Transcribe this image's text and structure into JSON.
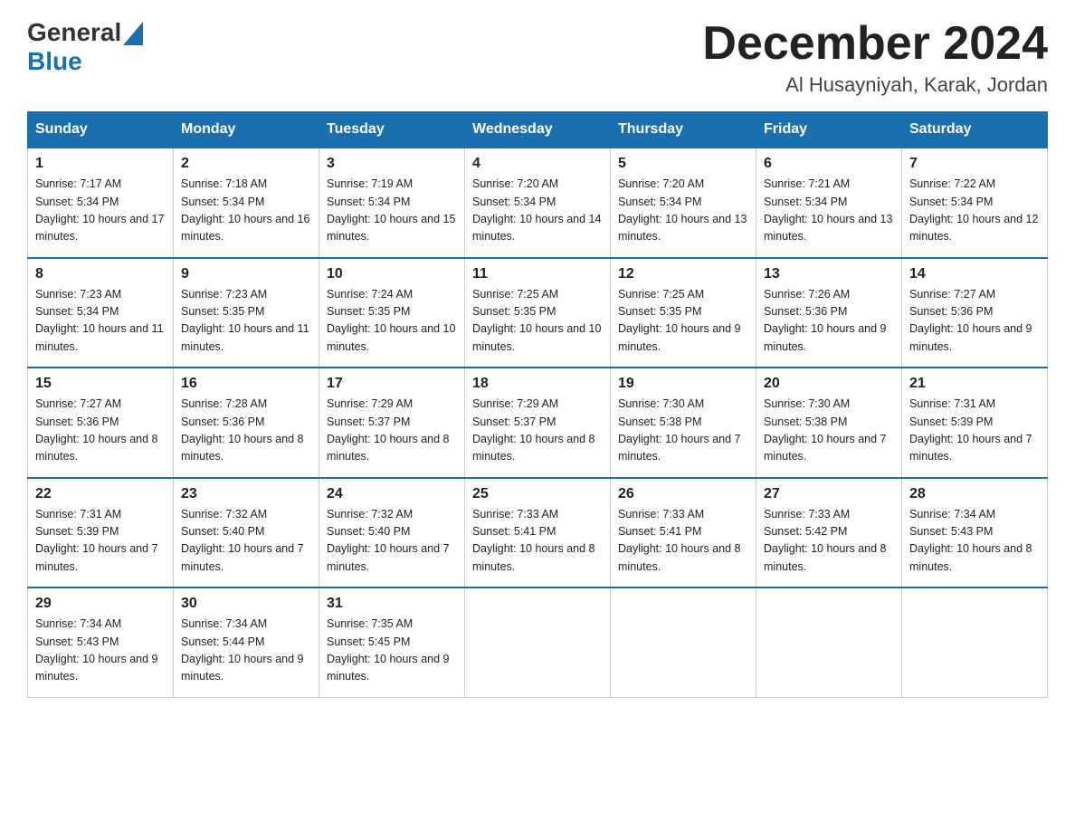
{
  "logo": {
    "text_general": "General",
    "text_blue": "Blue"
  },
  "title": {
    "month_year": "December 2024",
    "location": "Al Husayniyah, Karak, Jordan"
  },
  "days_of_week": [
    "Sunday",
    "Monday",
    "Tuesday",
    "Wednesday",
    "Thursday",
    "Friday",
    "Saturday"
  ],
  "weeks": [
    [
      {
        "day": "1",
        "sunrise": "7:17 AM",
        "sunset": "5:34 PM",
        "daylight": "10 hours and 17 minutes."
      },
      {
        "day": "2",
        "sunrise": "7:18 AM",
        "sunset": "5:34 PM",
        "daylight": "10 hours and 16 minutes."
      },
      {
        "day": "3",
        "sunrise": "7:19 AM",
        "sunset": "5:34 PM",
        "daylight": "10 hours and 15 minutes."
      },
      {
        "day": "4",
        "sunrise": "7:20 AM",
        "sunset": "5:34 PM",
        "daylight": "10 hours and 14 minutes."
      },
      {
        "day": "5",
        "sunrise": "7:20 AM",
        "sunset": "5:34 PM",
        "daylight": "10 hours and 13 minutes."
      },
      {
        "day": "6",
        "sunrise": "7:21 AM",
        "sunset": "5:34 PM",
        "daylight": "10 hours and 13 minutes."
      },
      {
        "day": "7",
        "sunrise": "7:22 AM",
        "sunset": "5:34 PM",
        "daylight": "10 hours and 12 minutes."
      }
    ],
    [
      {
        "day": "8",
        "sunrise": "7:23 AM",
        "sunset": "5:34 PM",
        "daylight": "10 hours and 11 minutes."
      },
      {
        "day": "9",
        "sunrise": "7:23 AM",
        "sunset": "5:35 PM",
        "daylight": "10 hours and 11 minutes."
      },
      {
        "day": "10",
        "sunrise": "7:24 AM",
        "sunset": "5:35 PM",
        "daylight": "10 hours and 10 minutes."
      },
      {
        "day": "11",
        "sunrise": "7:25 AM",
        "sunset": "5:35 PM",
        "daylight": "10 hours and 10 minutes."
      },
      {
        "day": "12",
        "sunrise": "7:25 AM",
        "sunset": "5:35 PM",
        "daylight": "10 hours and 9 minutes."
      },
      {
        "day": "13",
        "sunrise": "7:26 AM",
        "sunset": "5:36 PM",
        "daylight": "10 hours and 9 minutes."
      },
      {
        "day": "14",
        "sunrise": "7:27 AM",
        "sunset": "5:36 PM",
        "daylight": "10 hours and 9 minutes."
      }
    ],
    [
      {
        "day": "15",
        "sunrise": "7:27 AM",
        "sunset": "5:36 PM",
        "daylight": "10 hours and 8 minutes."
      },
      {
        "day": "16",
        "sunrise": "7:28 AM",
        "sunset": "5:36 PM",
        "daylight": "10 hours and 8 minutes."
      },
      {
        "day": "17",
        "sunrise": "7:29 AM",
        "sunset": "5:37 PM",
        "daylight": "10 hours and 8 minutes."
      },
      {
        "day": "18",
        "sunrise": "7:29 AM",
        "sunset": "5:37 PM",
        "daylight": "10 hours and 8 minutes."
      },
      {
        "day": "19",
        "sunrise": "7:30 AM",
        "sunset": "5:38 PM",
        "daylight": "10 hours and 7 minutes."
      },
      {
        "day": "20",
        "sunrise": "7:30 AM",
        "sunset": "5:38 PM",
        "daylight": "10 hours and 7 minutes."
      },
      {
        "day": "21",
        "sunrise": "7:31 AM",
        "sunset": "5:39 PM",
        "daylight": "10 hours and 7 minutes."
      }
    ],
    [
      {
        "day": "22",
        "sunrise": "7:31 AM",
        "sunset": "5:39 PM",
        "daylight": "10 hours and 7 minutes."
      },
      {
        "day": "23",
        "sunrise": "7:32 AM",
        "sunset": "5:40 PM",
        "daylight": "10 hours and 7 minutes."
      },
      {
        "day": "24",
        "sunrise": "7:32 AM",
        "sunset": "5:40 PM",
        "daylight": "10 hours and 7 minutes."
      },
      {
        "day": "25",
        "sunrise": "7:33 AM",
        "sunset": "5:41 PM",
        "daylight": "10 hours and 8 minutes."
      },
      {
        "day": "26",
        "sunrise": "7:33 AM",
        "sunset": "5:41 PM",
        "daylight": "10 hours and 8 minutes."
      },
      {
        "day": "27",
        "sunrise": "7:33 AM",
        "sunset": "5:42 PM",
        "daylight": "10 hours and 8 minutes."
      },
      {
        "day": "28",
        "sunrise": "7:34 AM",
        "sunset": "5:43 PM",
        "daylight": "10 hours and 8 minutes."
      }
    ],
    [
      {
        "day": "29",
        "sunrise": "7:34 AM",
        "sunset": "5:43 PM",
        "daylight": "10 hours and 9 minutes."
      },
      {
        "day": "30",
        "sunrise": "7:34 AM",
        "sunset": "5:44 PM",
        "daylight": "10 hours and 9 minutes."
      },
      {
        "day": "31",
        "sunrise": "7:35 AM",
        "sunset": "5:45 PM",
        "daylight": "10 hours and 9 minutes."
      },
      null,
      null,
      null,
      null
    ]
  ]
}
